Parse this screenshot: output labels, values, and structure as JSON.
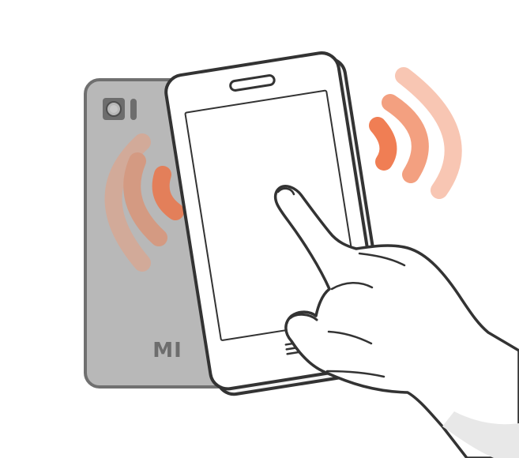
{
  "illustration": {
    "back_phone": {
      "brand_label": "MI",
      "body_color": "#b8b8b8",
      "outline_color": "#707070",
      "detail_color": "#6d6d6d"
    },
    "front_phone": {
      "body_color": "#ffffff",
      "outline_color": "#333333"
    },
    "hand": {
      "fill_color": "#ffffff",
      "outline_color": "#333333",
      "accent_color": "#e8e8e8"
    },
    "signal_colors": {
      "inner": "#f07e54",
      "middle": "#f3a080",
      "outer": "#f8c6b3",
      "back_inner": "#e37f5a",
      "back_middle": "#d49a82",
      "back_outer": "#d2aa99"
    },
    "icons": [
      "camera-icon",
      "flash-icon",
      "menu-icon",
      "signal-waves-icon",
      "hand-pointer-icon"
    ]
  }
}
